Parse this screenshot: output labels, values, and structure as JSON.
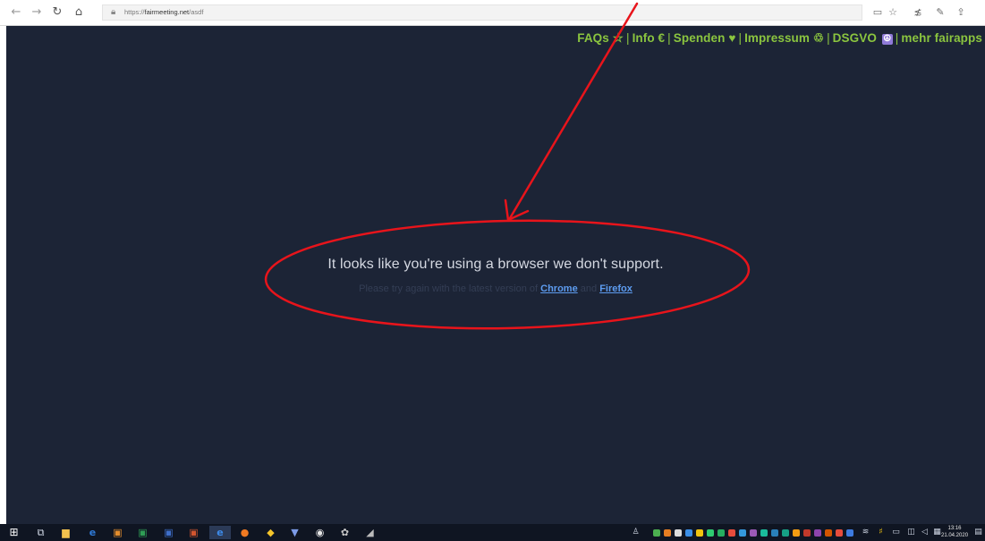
{
  "browser": {
    "url_prefix": "https://",
    "url_host": "fairmeeting.net",
    "url_path": "/asdf",
    "icons": {
      "back": "back-arrow-icon",
      "forward": "forward-arrow-icon",
      "refresh": "refresh-icon",
      "home": "home-icon",
      "lock": "lock-icon",
      "reading": "reading-view-icon",
      "favorite": "favorite-star-icon",
      "favorites": "favorites-list-icon",
      "notes": "pen-notes-icon",
      "share": "share-icon"
    }
  },
  "topnav": {
    "items": [
      {
        "label": "FAQs ☆"
      },
      {
        "label": "Info €"
      },
      {
        "label": "Spenden ♥"
      },
      {
        "label": "Impressum ♲"
      },
      {
        "label": "DSGVO"
      },
      {
        "label": "mehr fairapps"
      }
    ],
    "separator": "|",
    "dsgvo_badge": "☮"
  },
  "message": {
    "title": "It looks like you're using a browser we don't support.",
    "sub_prefix": "Please try again with the latest version of",
    "link_chrome": "Chrome",
    "sub_and": "and",
    "link_firefox": "Firefox"
  },
  "taskbar": {
    "clock_time": "13:16",
    "clock_date": "21.04.2020"
  },
  "colors": {
    "page_bg": "#1c2436",
    "nav_green": "#8bc53f",
    "annotation_red": "#e8141b",
    "link_blue": "#5d9cf0"
  }
}
